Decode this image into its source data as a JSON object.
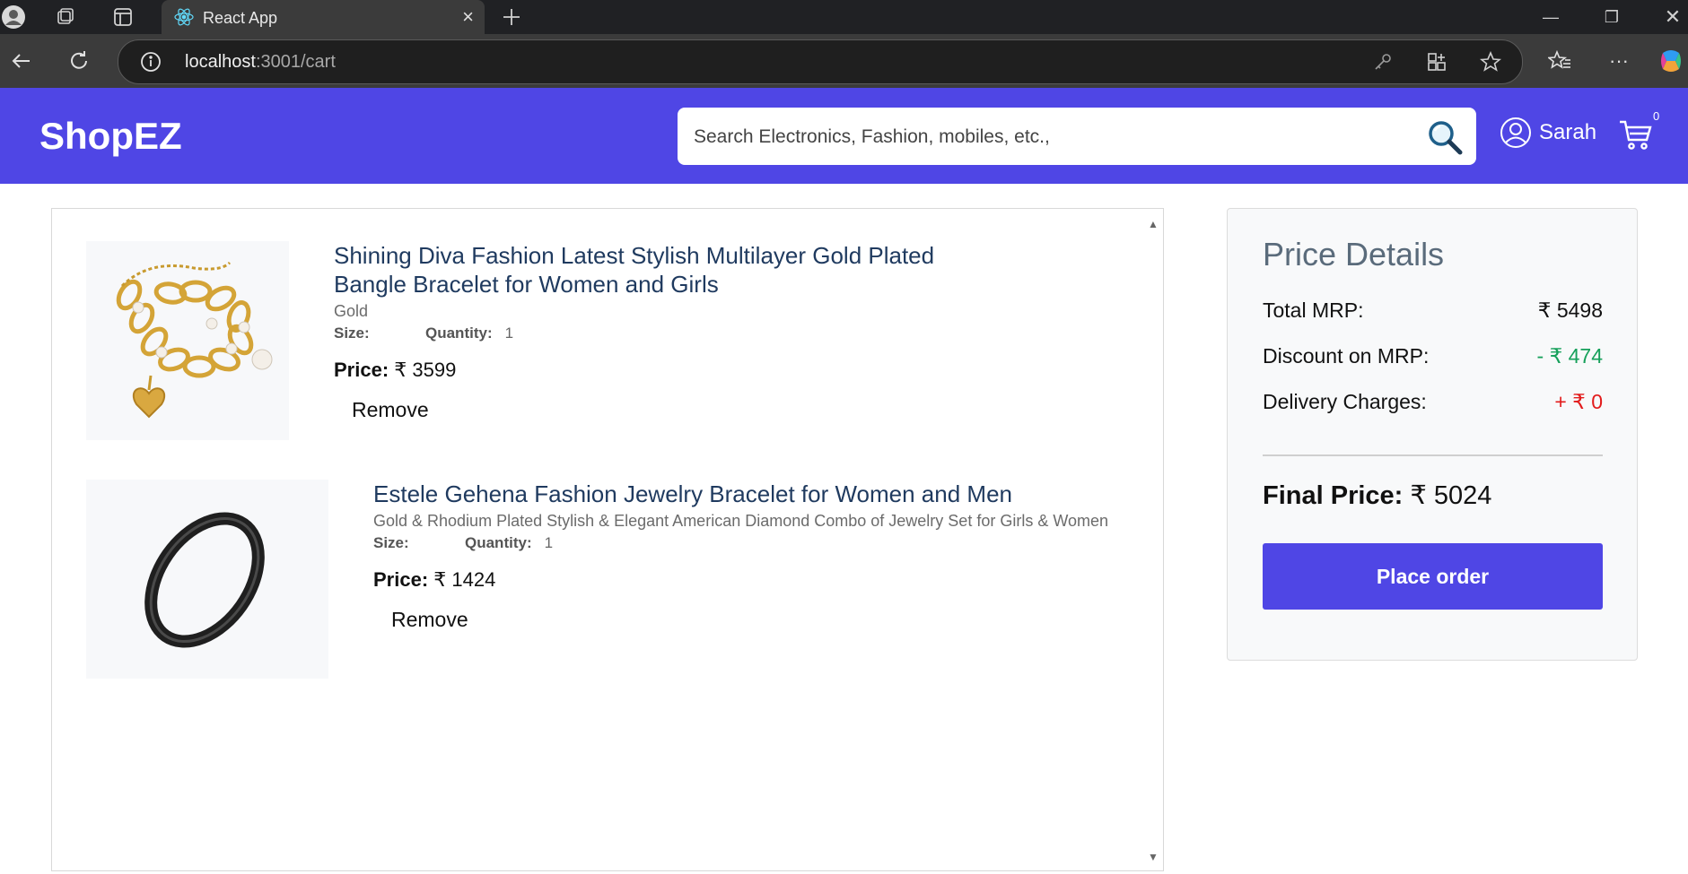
{
  "browser": {
    "tab_title": "React App",
    "url_host": "localhost",
    "url_rest": ":3001/cart"
  },
  "header": {
    "brand": "ShopEZ",
    "search_placeholder": "Search Electronics, Fashion, mobiles, etc.,",
    "user_name": "Sarah",
    "cart_count": "0"
  },
  "cart": {
    "items": [
      {
        "title": "Shining Diva Fashion Latest Stylish Multilayer Gold Plated Bangle Bracelet for Women and Girls",
        "description": "Gold",
        "size_label": "Size:",
        "size_value": "",
        "quantity_label": "Quantity:",
        "quantity_value": "1",
        "price_label": "Price:",
        "price_value": "₹ 3599",
        "remove_label": "Remove"
      },
      {
        "title": "Estele Gehena Fashion Jewelry Bracelet for Women and Men",
        "description": "Gold & Rhodium Plated Stylish & Elegant American Diamond Combo of Jewelry Set for Girls & Women",
        "size_label": "Size:",
        "size_value": "",
        "quantity_label": "Quantity:",
        "quantity_value": "1",
        "price_label": "Price:",
        "price_value": "₹ 1424",
        "remove_label": "Remove"
      }
    ]
  },
  "price_details": {
    "title": "Price Details",
    "total_mrp_label": "Total MRP:",
    "total_mrp_value": "₹ 5498",
    "discount_label": "Discount on MRP:",
    "discount_value": "- ₹ 474",
    "delivery_label": "Delivery Charges:",
    "delivery_value": "+ ₹ 0",
    "final_label": "Final Price:",
    "final_value": "₹ 5024",
    "place_order_label": "Place order"
  },
  "colors": {
    "brand": "#4f46e5",
    "discount": "#16a05a",
    "delivery": "#e21b1b"
  }
}
